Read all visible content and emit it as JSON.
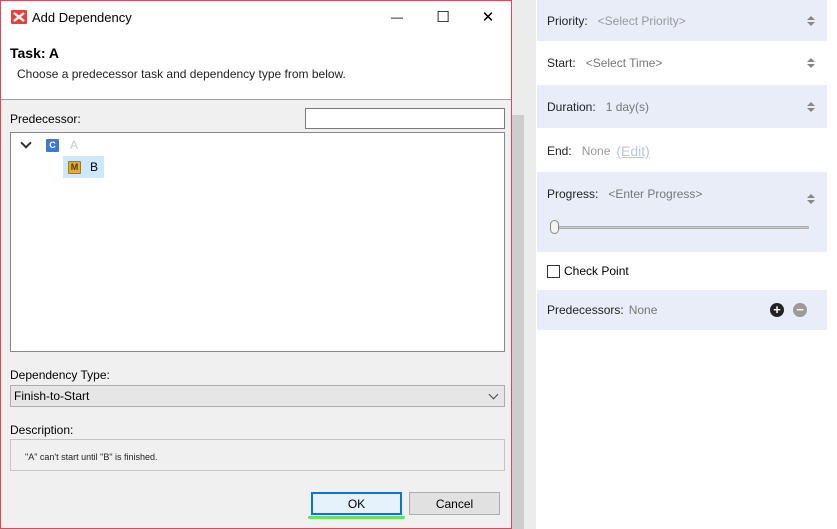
{
  "dialog": {
    "title": "Add Dependency",
    "task_title": "Task: A",
    "task_desc": "Choose a predecessor task and dependency type from below.",
    "predecessor_label": "Predecessor:",
    "search_value": "",
    "tree": {
      "root": {
        "icon_letter": "C",
        "label": "A"
      },
      "child": {
        "icon_letter": "M",
        "label": "B"
      }
    },
    "dependency_type_label": "Dependency Type:",
    "dependency_type_value": "Finish-to-Start",
    "description_label": "Description:",
    "description_text": "\"A\" can't start until \"B\" is finished.",
    "ok_label": "OK",
    "cancel_label": "Cancel",
    "window_buttons": {
      "minimize": "—",
      "maximize": "☐",
      "close": "✕"
    }
  },
  "properties": {
    "priority": {
      "label": "Priority:",
      "value": "<Select Priority>"
    },
    "start": {
      "label": "Start:",
      "value": "<Select Time>"
    },
    "duration": {
      "label": "Duration:",
      "value": "1 day(s)"
    },
    "end": {
      "label": "End:",
      "value": "None",
      "edit_label": "(Edit)"
    },
    "progress": {
      "label": "Progress:",
      "value": "<Enter Progress>",
      "level": 0
    },
    "checkpoint": {
      "label": "Check Point",
      "checked": false
    },
    "predecessors": {
      "label": "Predecessors:",
      "value": "None",
      "add_symbol": "+",
      "remove_symbol": "−"
    }
  },
  "colors": {
    "accent": "#0078d7",
    "dialog_border": "#d94a5a",
    "panel_shade": "#e8edf7",
    "selection": "#cde8ff",
    "focus_highlight": "#6ee05a"
  }
}
